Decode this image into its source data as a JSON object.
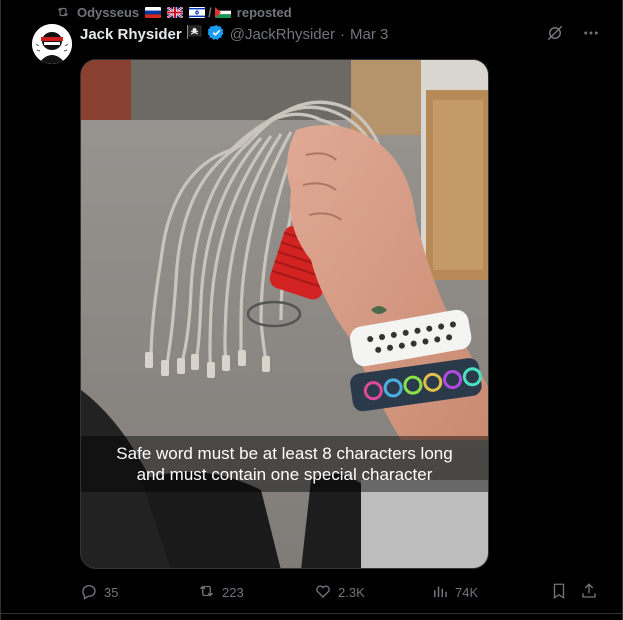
{
  "repost": {
    "reposter_name": "Odysseus",
    "flags": [
      "flag-russia",
      "flag-uk",
      "flag-israel",
      "flag-palestine"
    ],
    "separator": "/",
    "label": "reposted"
  },
  "post": {
    "display_name": "Jack Rhysider",
    "name_emoji": "🏴‍☠️",
    "handle": "@JackRhysider",
    "dot": "·",
    "date": "Mar 3",
    "verified_color": "#1d9bf0",
    "image_caption_line1": "Safe word must be at least 8 characters long",
    "image_caption_line2": "and must contain one special character"
  },
  "actions": {
    "replies": "35",
    "reposts": "223",
    "likes": "2.3K",
    "views": "74K"
  },
  "colors": {
    "background": "#000000",
    "text_primary": "#e7e9ea",
    "text_secondary": "#71767b",
    "border": "#2f3336"
  }
}
